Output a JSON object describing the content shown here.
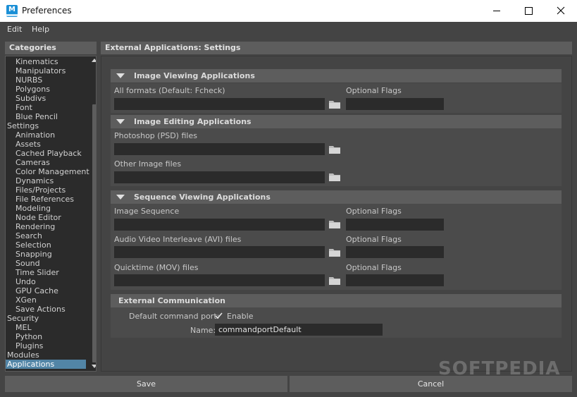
{
  "window": {
    "title": "Preferences"
  },
  "menu": [
    "Edit",
    "Help"
  ],
  "categories_header": "Categories",
  "content_header": "External Applications: Settings",
  "categories": [
    {
      "label": "Kinematics",
      "level": 1
    },
    {
      "label": "Manipulators",
      "level": 1
    },
    {
      "label": "NURBS",
      "level": 1
    },
    {
      "label": "Polygons",
      "level": 1
    },
    {
      "label": "Subdivs",
      "level": 1
    },
    {
      "label": "Font",
      "level": 1
    },
    {
      "label": "Blue Pencil",
      "level": 1
    },
    {
      "label": "Settings",
      "level": 0
    },
    {
      "label": "Animation",
      "level": 1
    },
    {
      "label": "Assets",
      "level": 1
    },
    {
      "label": "Cached Playback",
      "level": 1
    },
    {
      "label": "Cameras",
      "level": 1
    },
    {
      "label": "Color Management",
      "level": 1
    },
    {
      "label": "Dynamics",
      "level": 1
    },
    {
      "label": "Files/Projects",
      "level": 1
    },
    {
      "label": "File References",
      "level": 1
    },
    {
      "label": "Modeling",
      "level": 1
    },
    {
      "label": "Node Editor",
      "level": 1
    },
    {
      "label": "Rendering",
      "level": 1
    },
    {
      "label": "Search",
      "level": 1
    },
    {
      "label": "Selection",
      "level": 1
    },
    {
      "label": "Snapping",
      "level": 1
    },
    {
      "label": "Sound",
      "level": 1
    },
    {
      "label": "Time Slider",
      "level": 1
    },
    {
      "label": "Undo",
      "level": 1
    },
    {
      "label": "GPU Cache",
      "level": 1
    },
    {
      "label": "XGen",
      "level": 1
    },
    {
      "label": "Save Actions",
      "level": 1
    },
    {
      "label": "Security",
      "level": 0
    },
    {
      "label": "MEL",
      "level": 1
    },
    {
      "label": "Python",
      "level": 1
    },
    {
      "label": "Plugins",
      "level": 1
    },
    {
      "label": "Modules",
      "level": 0
    },
    {
      "label": "Applications",
      "level": 0,
      "selected": true
    }
  ],
  "sections": {
    "image_viewing": {
      "title": "Image Viewing Applications",
      "all_formats_label": "All formats (Default: Fcheck)",
      "optional_flags_label": "Optional Flags",
      "all_formats_value": "",
      "optional_flags_value": ""
    },
    "image_editing": {
      "title": "Image Editing Applications",
      "psd_label": "Photoshop (PSD) files",
      "other_label": "Other Image files",
      "psd_value": "",
      "other_value": ""
    },
    "sequence_viewing": {
      "title": "Sequence Viewing Applications",
      "image_sequence_label": "Image Sequence",
      "avi_label": "Audio Video Interleave (AVI) files",
      "mov_label": "Quicktime (MOV) files",
      "optional_flags_label": "Optional Flags",
      "image_sequence_value": "",
      "avi_value": "",
      "mov_value": "",
      "flags_1": "",
      "flags_2": "",
      "flags_3": ""
    },
    "external_comm": {
      "title": "External Communication",
      "port_label": "Default command port:",
      "enable_label": "Enable",
      "enable_checked": true,
      "name_label": "Name:",
      "name_value": "commandportDefault"
    }
  },
  "buttons": {
    "save": "Save",
    "cancel": "Cancel"
  },
  "watermark": "SOFTPEDIA",
  "colors": {
    "selection": "#5285a6",
    "panel": "#444444",
    "field": "#2b2b2b",
    "header": "#5d5d5d"
  }
}
